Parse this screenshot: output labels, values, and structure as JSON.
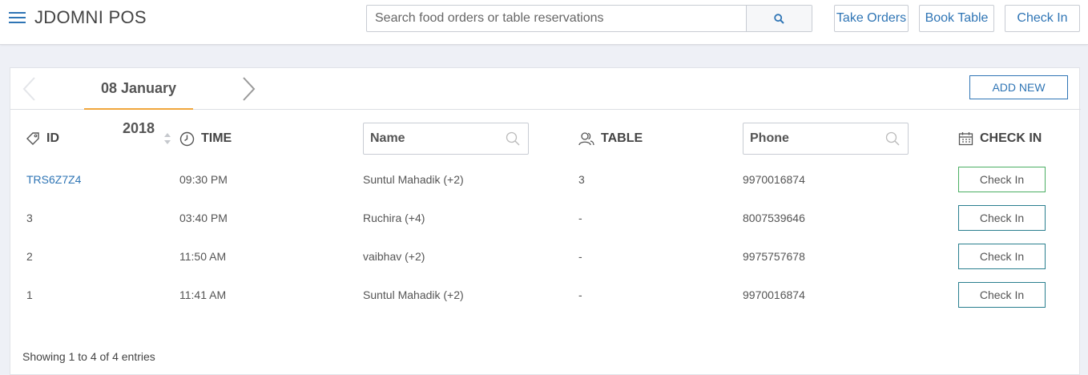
{
  "header": {
    "brand": "JDOMNI POS",
    "search_placeholder": "Search food orders or table reservations",
    "buttons": {
      "take_orders": "Take Orders",
      "book_table": "Book Table",
      "check_in": "Check In"
    }
  },
  "date_bar": {
    "date": "08 January 2018",
    "add_new": "ADD NEW"
  },
  "table": {
    "columns": {
      "id": "ID",
      "time": "TIME",
      "name_placeholder": "Name",
      "table": "TABLE",
      "phone_placeholder": "Phone",
      "check_in": "CHECK IN"
    },
    "rows": [
      {
        "id": "TRS6Z7Z4",
        "time": "09:30 PM",
        "name": "Suntul Mahadik (+2)",
        "table": "3",
        "phone": "9970016874",
        "action": "Check In"
      },
      {
        "id": "3",
        "time": "03:40 PM",
        "name": "Ruchira (+4)",
        "table": "-",
        "phone": "8007539646",
        "action": "Check In"
      },
      {
        "id": "2",
        "time": "11:50 AM",
        "name": "vaibhav (+2)",
        "table": "-",
        "phone": "9975757678",
        "action": "Check In"
      },
      {
        "id": "1",
        "time": "11:41 AM",
        "name": "Suntul Mahadik (+2)",
        "table": "-",
        "phone": "9970016874",
        "action": "Check In"
      }
    ],
    "footer": "Showing 1 to 4 of 4 entries"
  },
  "colors": {
    "accent": "#2f75b5",
    "date_underline": "#f0a63c",
    "active_border": "#4caf63",
    "button_border": "#2a7f8f"
  }
}
